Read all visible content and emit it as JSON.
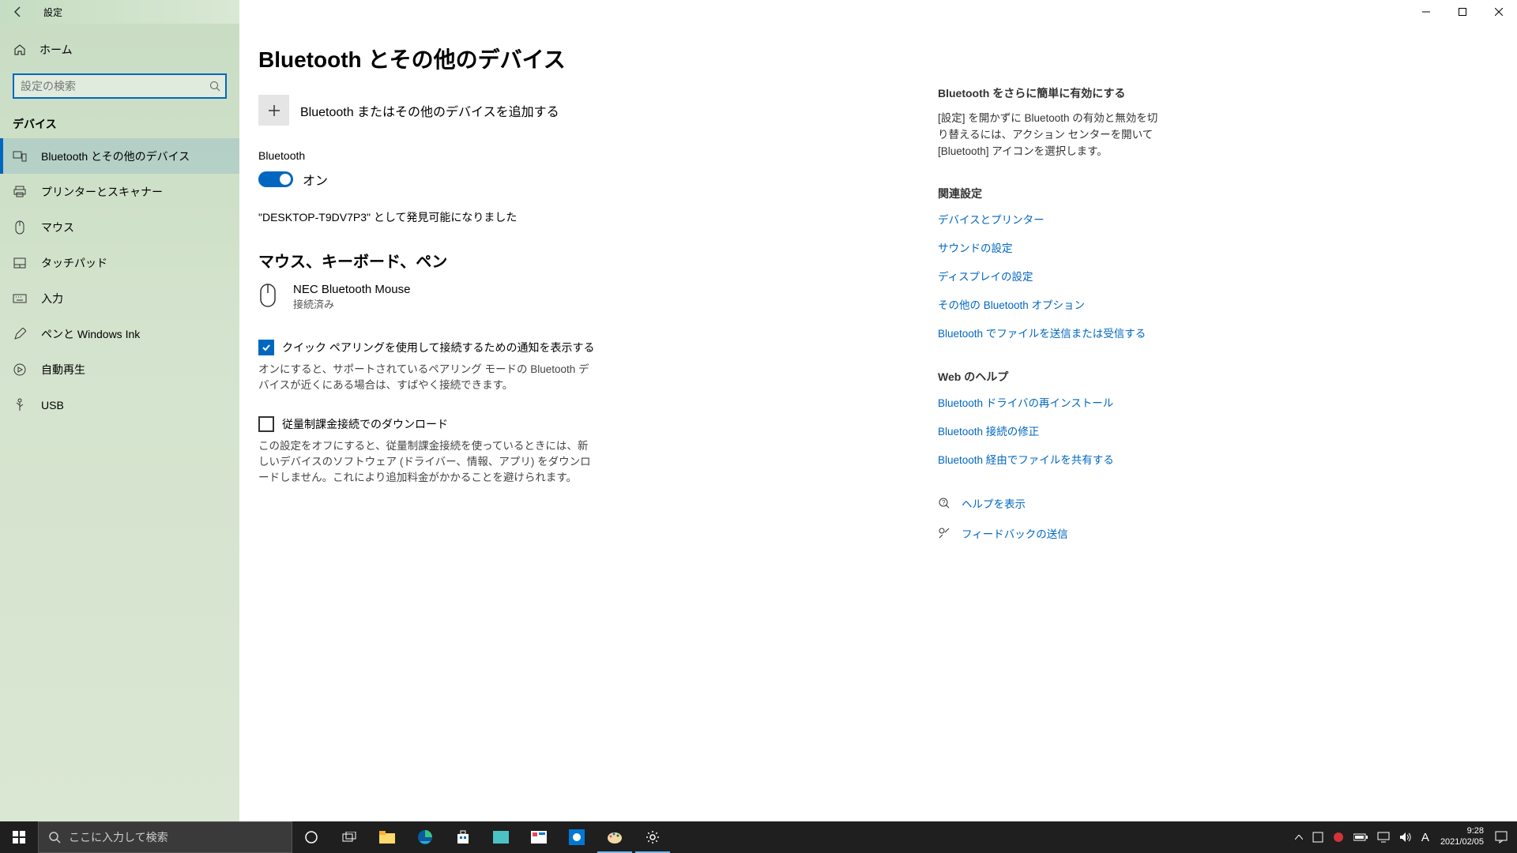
{
  "window": {
    "title": "設定"
  },
  "sidebar": {
    "home": "ホーム",
    "search_placeholder": "設定の検索",
    "category": "デバイス",
    "items": [
      {
        "label": "Bluetooth とその他のデバイス"
      },
      {
        "label": "プリンターとスキャナー"
      },
      {
        "label": "マウス"
      },
      {
        "label": "タッチパッド"
      },
      {
        "label": "入力"
      },
      {
        "label": "ペンと Windows Ink"
      },
      {
        "label": "自動再生"
      },
      {
        "label": "USB"
      }
    ]
  },
  "main": {
    "title": "Bluetooth とその他のデバイス",
    "add_device": "Bluetooth またはその他のデバイスを追加する",
    "bt_label": "Bluetooth",
    "bt_state": "オン",
    "discover": "\"DESKTOP-T9DV7P3\" として発見可能になりました",
    "group1": "マウス、キーボード、ペン",
    "device1_name": "NEC Bluetooth Mouse",
    "device1_status": "接続済み",
    "check1_label": "クイック ペアリングを使用して接続するための通知を表示する",
    "check1_desc": "オンにすると、サポートされているペアリング モードの Bluetooth デバイスが近くにある場合は、すばやく接続できます。",
    "check2_label": "従量制課金接続でのダウンロード",
    "check2_desc": "この設定をオフにすると、従量制課金接続を使っているときには、新しいデバイスのソフトウェア (ドライバー、情報、アプリ) をダウンロードしません。これにより追加料金がかかることを避けられます。"
  },
  "right": {
    "h1": "Bluetooth をさらに簡単に有効にする",
    "p1": "[設定] を開かずに Bluetooth の有効と無効を切り替えるには、アクション センターを開いて [Bluetooth] アイコンを選択します。",
    "h2": "関連設定",
    "links2": [
      "デバイスとプリンター",
      "サウンドの設定",
      "ディスプレイの設定",
      "その他の Bluetooth オプション",
      "Bluetooth でファイルを送信または受信する"
    ],
    "h3": "Web のヘルプ",
    "links3": [
      "Bluetooth ドライバの再インストール",
      "Bluetooth 接続の修正",
      "Bluetooth 経由でファイルを共有する"
    ],
    "help": "ヘルプを表示",
    "feedback": "フィードバックの送信"
  },
  "taskbar": {
    "search": "ここに入力して検索",
    "time": "9:28",
    "date": "2021/02/05",
    "ime": "A"
  }
}
